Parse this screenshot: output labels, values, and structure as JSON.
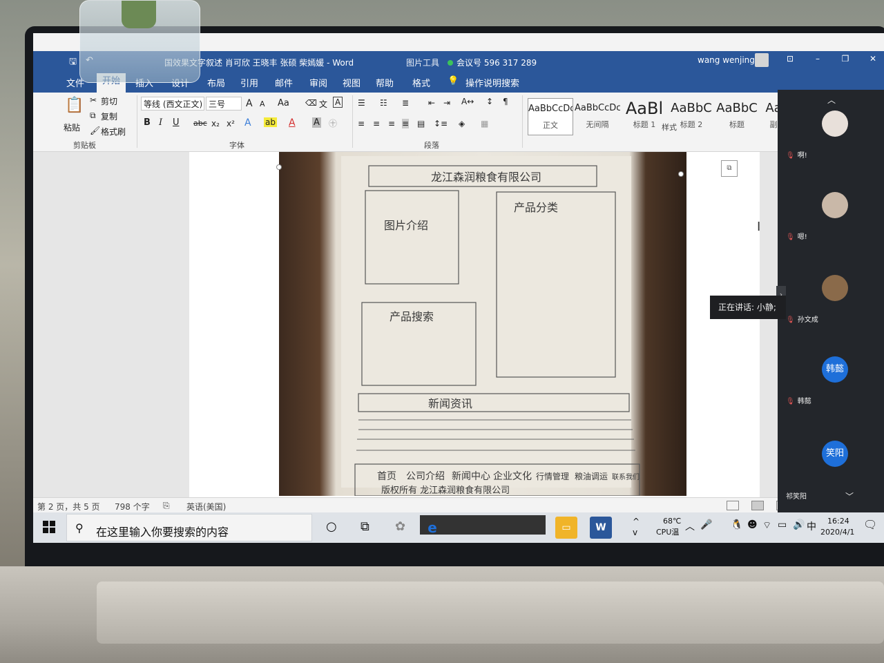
{
  "window": {
    "doc_title": "国效果文字叙述 肖可欣 王晓丰 张硕 柴嫣媛  -  Word",
    "context_tab": "图片工具",
    "meeting_id": "会议号 596 317 289",
    "user_name": "wang wenjing",
    "btn_ribbon_display": "⊡",
    "btn_minimize": "–",
    "btn_restore": "❐",
    "btn_close": "✕"
  },
  "qat": {
    "save_icon": "🖫",
    "undo_icon": "↶"
  },
  "ribbon_tabs": {
    "file": "文件",
    "home": "开始",
    "insert": "插入",
    "design": "设计",
    "layout": "布局",
    "references": "引用",
    "mailings": "邮件",
    "review": "审阅",
    "view": "视图",
    "help": "帮助",
    "format": "格式",
    "tell_me": "操作说明搜索"
  },
  "clipboard": {
    "paste": "粘贴",
    "cut": "剪切",
    "copy": "复制",
    "format_painter": "格式刷",
    "label": "剪贴板"
  },
  "font": {
    "font_name": "等线 (西文正文)",
    "font_size": "三号",
    "grow": "A",
    "shrink": "A",
    "case": "Aa",
    "bold": "B",
    "italic": "I",
    "underline": "U",
    "strike": "abc",
    "subscript": "x₂",
    "superscript": "x²",
    "label": "字体"
  },
  "paragraph": {
    "label": "段落"
  },
  "styles": {
    "items": [
      {
        "preview": "AaBbCcDc",
        "name": "正文"
      },
      {
        "preview": "AaBbCcDc",
        "name": "无间隔"
      },
      {
        "preview": "AaBl",
        "name": "标题 1"
      },
      {
        "preview": "AaBbC",
        "name": "标题 2"
      },
      {
        "preview": "AaBbC",
        "name": "标题"
      },
      {
        "preview": "Aa",
        "name": "副"
      }
    ],
    "label": "样式"
  },
  "sketch": {
    "header": "龙江森润粮食有限公司",
    "intro": "图片介绍",
    "category": "产品分类",
    "search": "产品搜索",
    "news": "新闻资讯",
    "nav": [
      "首页",
      "公司介绍",
      "新闻中心",
      "企业文化",
      "行情管理",
      "粮油调运",
      "联系我们"
    ],
    "footer": "版权所有 龙江森润粮食有限公司"
  },
  "statusbar": {
    "page": "第 2 页，共 5 页",
    "words": "798 个字",
    "language": "英语(美国)"
  },
  "meeting": {
    "speaking": "正在讲话: 小静;",
    "participants": [
      {
        "avatar": "",
        "name": "啊!"
      },
      {
        "avatar": "",
        "name": "嗯!"
      },
      {
        "avatar": "",
        "name": "孙文成"
      },
      {
        "avatar": "韩懿",
        "name": "韩懿"
      },
      {
        "avatar": "笑阳",
        "name": "祁笑阳"
      }
    ]
  },
  "taskbar": {
    "search_placeholder": "在这里输入你要搜索的内容",
    "temp": "68℃",
    "cpu": "CPU温",
    "ime": "中",
    "time": "16:24",
    "date": "2020/4/1"
  },
  "colors": {
    "word_blue": "#2b579a",
    "avatar_blue": "#1e6fd9"
  }
}
